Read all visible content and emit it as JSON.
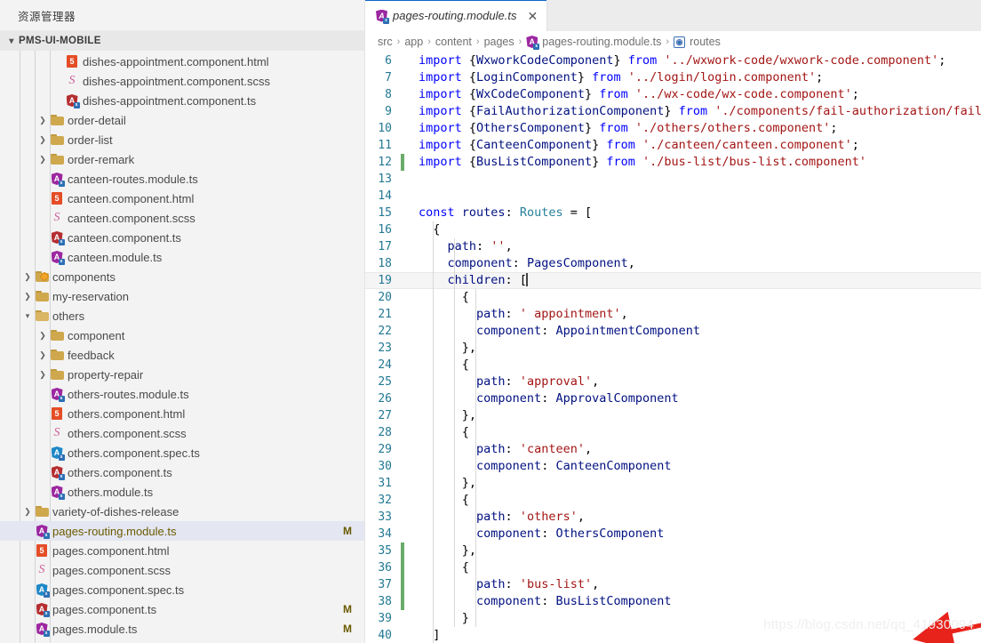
{
  "sidebar": {
    "title": "资源管理器",
    "root_label": "PMS-UI-MOBILE",
    "items": [
      {
        "label": "dishes-appointment.component.html",
        "icon": "html-icon",
        "kind": "file",
        "indent": 3,
        "badge": ""
      },
      {
        "label": "dishes-appointment.component.scss",
        "icon": "scss-icon",
        "kind": "file",
        "indent": 3,
        "badge": ""
      },
      {
        "label": "dishes-appointment.component.ts",
        "icon": "angular-component-icon",
        "kind": "file",
        "indent": 3,
        "badge": ""
      },
      {
        "label": "order-detail",
        "icon": "folder-icon",
        "kind": "folder",
        "indent": 2,
        "state": "collapsed",
        "badge": ""
      },
      {
        "label": "order-list",
        "icon": "folder-icon",
        "kind": "folder",
        "indent": 2,
        "state": "collapsed",
        "badge": ""
      },
      {
        "label": "order-remark",
        "icon": "folder-icon",
        "kind": "folder",
        "indent": 2,
        "state": "collapsed",
        "badge": ""
      },
      {
        "label": "canteen-routes.module.ts",
        "icon": "angular-module-icon",
        "kind": "file",
        "indent": 2,
        "badge": ""
      },
      {
        "label": "canteen.component.html",
        "icon": "html-icon",
        "kind": "file",
        "indent": 2,
        "badge": ""
      },
      {
        "label": "canteen.component.scss",
        "icon": "scss-icon",
        "kind": "file",
        "indent": 2,
        "badge": ""
      },
      {
        "label": "canteen.component.ts",
        "icon": "angular-component-icon",
        "kind": "file",
        "indent": 2,
        "badge": ""
      },
      {
        "label": "canteen.module.ts",
        "icon": "angular-module-icon",
        "kind": "file",
        "indent": 2,
        "badge": ""
      },
      {
        "label": "components",
        "icon": "folder-components-icon",
        "kind": "folder",
        "indent": 1,
        "state": "collapsed",
        "badge": ""
      },
      {
        "label": "my-reservation",
        "icon": "folder-icon",
        "kind": "folder",
        "indent": 1,
        "state": "collapsed",
        "badge": ""
      },
      {
        "label": "others",
        "icon": "folder-open-icon",
        "kind": "folder",
        "indent": 1,
        "state": "expanded",
        "badge": ""
      },
      {
        "label": "component",
        "icon": "folder-icon",
        "kind": "folder",
        "indent": 2,
        "state": "collapsed",
        "badge": ""
      },
      {
        "label": "feedback",
        "icon": "folder-icon",
        "kind": "folder",
        "indent": 2,
        "state": "collapsed",
        "badge": ""
      },
      {
        "label": "property-repair",
        "icon": "folder-icon",
        "kind": "folder",
        "indent": 2,
        "state": "collapsed",
        "badge": ""
      },
      {
        "label": "others-routes.module.ts",
        "icon": "angular-module-icon",
        "kind": "file",
        "indent": 2,
        "badge": ""
      },
      {
        "label": "others.component.html",
        "icon": "html-icon",
        "kind": "file",
        "indent": 2,
        "badge": ""
      },
      {
        "label": "others.component.scss",
        "icon": "scss-icon",
        "kind": "file",
        "indent": 2,
        "badge": ""
      },
      {
        "label": "others.component.spec.ts",
        "icon": "angular-spec-icon",
        "kind": "file",
        "indent": 2,
        "badge": ""
      },
      {
        "label": "others.component.ts",
        "icon": "angular-component-icon",
        "kind": "file",
        "indent": 2,
        "badge": ""
      },
      {
        "label": "others.module.ts",
        "icon": "angular-module-icon",
        "kind": "file",
        "indent": 2,
        "badge": ""
      },
      {
        "label": "variety-of-dishes-release",
        "icon": "folder-icon",
        "kind": "folder",
        "indent": 1,
        "state": "collapsed",
        "badge": ""
      },
      {
        "label": "pages-routing.module.ts",
        "icon": "angular-module-icon",
        "kind": "file",
        "indent": 1,
        "badge": "M",
        "selected": true
      },
      {
        "label": "pages.component.html",
        "icon": "html-icon",
        "kind": "file",
        "indent": 1,
        "badge": ""
      },
      {
        "label": "pages.component.scss",
        "icon": "scss-icon",
        "kind": "file",
        "indent": 1,
        "badge": ""
      },
      {
        "label": "pages.component.spec.ts",
        "icon": "angular-spec-icon",
        "kind": "file",
        "indent": 1,
        "badge": ""
      },
      {
        "label": "pages.component.ts",
        "icon": "angular-component-icon",
        "kind": "file",
        "indent": 1,
        "badge": "M"
      },
      {
        "label": "pages.module.ts",
        "icon": "angular-module-icon",
        "kind": "file",
        "indent": 1,
        "badge": "M"
      }
    ]
  },
  "editor": {
    "tab": {
      "label": "pages-routing.module.ts",
      "icon": "angular-module-icon",
      "close_label": "✕"
    },
    "breadcrumb": [
      "src",
      "app",
      "content",
      "pages",
      "pages-routing.module.ts",
      "routes"
    ],
    "breadcrumb_separator": "›",
    "lines": [
      {
        "n": 6,
        "mod": false,
        "tokens": [
          {
            "t": "kw",
            "v": "import"
          },
          {
            "t": "pn",
            "v": " {"
          },
          {
            "t": "id",
            "v": "WxworkCodeComponent"
          },
          {
            "t": "pn",
            "v": "} "
          },
          {
            "t": "kw",
            "v": "from"
          },
          {
            "t": "pn",
            "v": " "
          },
          {
            "t": "str",
            "v": "'../wxwork-code/wxwork-code.component'"
          },
          {
            "t": "pn",
            "v": ";"
          }
        ]
      },
      {
        "n": 7,
        "mod": false,
        "tokens": [
          {
            "t": "kw",
            "v": "import"
          },
          {
            "t": "pn",
            "v": " {"
          },
          {
            "t": "id",
            "v": "LoginComponent"
          },
          {
            "t": "pn",
            "v": "} "
          },
          {
            "t": "kw",
            "v": "from"
          },
          {
            "t": "pn",
            "v": " "
          },
          {
            "t": "str",
            "v": "'../login/login.component'"
          },
          {
            "t": "pn",
            "v": ";"
          }
        ]
      },
      {
        "n": 8,
        "mod": false,
        "tokens": [
          {
            "t": "kw",
            "v": "import"
          },
          {
            "t": "pn",
            "v": " {"
          },
          {
            "t": "id",
            "v": "WxCodeComponent"
          },
          {
            "t": "pn",
            "v": "} "
          },
          {
            "t": "kw",
            "v": "from"
          },
          {
            "t": "pn",
            "v": " "
          },
          {
            "t": "str",
            "v": "'../wx-code/wx-code.component'"
          },
          {
            "t": "pn",
            "v": ";"
          }
        ]
      },
      {
        "n": 9,
        "mod": false,
        "tokens": [
          {
            "t": "kw",
            "v": "import"
          },
          {
            "t": "pn",
            "v": " {"
          },
          {
            "t": "id",
            "v": "FailAuthorizationComponent"
          },
          {
            "t": "pn",
            "v": "} "
          },
          {
            "t": "kw",
            "v": "from"
          },
          {
            "t": "pn",
            "v": " "
          },
          {
            "t": "str",
            "v": "'./components/fail-authorization/fail-au"
          }
        ]
      },
      {
        "n": 10,
        "mod": false,
        "tokens": [
          {
            "t": "kw",
            "v": "import"
          },
          {
            "t": "pn",
            "v": " {"
          },
          {
            "t": "id",
            "v": "OthersComponent"
          },
          {
            "t": "pn",
            "v": "} "
          },
          {
            "t": "kw",
            "v": "from"
          },
          {
            "t": "pn",
            "v": " "
          },
          {
            "t": "str",
            "v": "'./others/others.component'"
          },
          {
            "t": "pn",
            "v": ";"
          }
        ]
      },
      {
        "n": 11,
        "mod": false,
        "tokens": [
          {
            "t": "kw",
            "v": "import"
          },
          {
            "t": "pn",
            "v": " {"
          },
          {
            "t": "id",
            "v": "CanteenComponent"
          },
          {
            "t": "pn",
            "v": "} "
          },
          {
            "t": "kw",
            "v": "from"
          },
          {
            "t": "pn",
            "v": " "
          },
          {
            "t": "str",
            "v": "'./canteen/canteen.component'"
          },
          {
            "t": "pn",
            "v": ";"
          }
        ]
      },
      {
        "n": 12,
        "mod": true,
        "tokens": [
          {
            "t": "kw",
            "v": "import"
          },
          {
            "t": "pn",
            "v": " {"
          },
          {
            "t": "id",
            "v": "BusListComponent"
          },
          {
            "t": "pn",
            "v": "} "
          },
          {
            "t": "kw",
            "v": "from"
          },
          {
            "t": "pn",
            "v": " "
          },
          {
            "t": "str",
            "v": "'./bus-list/bus-list.component'"
          }
        ]
      },
      {
        "n": 13,
        "mod": false,
        "tokens": []
      },
      {
        "n": 14,
        "mod": false,
        "tokens": []
      },
      {
        "n": 15,
        "mod": false,
        "tokens": [
          {
            "t": "kw",
            "v": "const"
          },
          {
            "t": "pn",
            "v": " "
          },
          {
            "t": "id",
            "v": "routes"
          },
          {
            "t": "pn",
            "v": ": "
          },
          {
            "t": "ty",
            "v": "Routes"
          },
          {
            "t": "pn",
            "v": " = ["
          }
        ]
      },
      {
        "n": 16,
        "mod": false,
        "tokens": [
          {
            "t": "pn",
            "v": "  {"
          }
        ]
      },
      {
        "n": 17,
        "mod": false,
        "tokens": [
          {
            "t": "pn",
            "v": "    "
          },
          {
            "t": "id",
            "v": "path"
          },
          {
            "t": "pn",
            "v": ": "
          },
          {
            "t": "str",
            "v": "''"
          },
          {
            "t": "pn",
            "v": ","
          }
        ]
      },
      {
        "n": 18,
        "mod": false,
        "tokens": [
          {
            "t": "pn",
            "v": "    "
          },
          {
            "t": "id",
            "v": "component"
          },
          {
            "t": "pn",
            "v": ": "
          },
          {
            "t": "id",
            "v": "PagesComponent"
          },
          {
            "t": "pn",
            "v": ","
          }
        ]
      },
      {
        "n": 19,
        "mod": false,
        "current": true,
        "cursor": true,
        "tokens": [
          {
            "t": "pn",
            "v": "    "
          },
          {
            "t": "id",
            "v": "children"
          },
          {
            "t": "pn",
            "v": ": ["
          }
        ]
      },
      {
        "n": 20,
        "mod": false,
        "tokens": [
          {
            "t": "pn",
            "v": "      {"
          }
        ]
      },
      {
        "n": 21,
        "mod": false,
        "tokens": [
          {
            "t": "pn",
            "v": "        "
          },
          {
            "t": "id",
            "v": "path"
          },
          {
            "t": "pn",
            "v": ": "
          },
          {
            "t": "str",
            "v": "' appointment'"
          },
          {
            "t": "pn",
            "v": ","
          }
        ]
      },
      {
        "n": 22,
        "mod": false,
        "tokens": [
          {
            "t": "pn",
            "v": "        "
          },
          {
            "t": "id",
            "v": "component"
          },
          {
            "t": "pn",
            "v": ": "
          },
          {
            "t": "id",
            "v": "AppointmentComponent"
          }
        ]
      },
      {
        "n": 23,
        "mod": false,
        "tokens": [
          {
            "t": "pn",
            "v": "      },"
          }
        ]
      },
      {
        "n": 24,
        "mod": false,
        "tokens": [
          {
            "t": "pn",
            "v": "      {"
          }
        ]
      },
      {
        "n": 25,
        "mod": false,
        "tokens": [
          {
            "t": "pn",
            "v": "        "
          },
          {
            "t": "id",
            "v": "path"
          },
          {
            "t": "pn",
            "v": ": "
          },
          {
            "t": "str",
            "v": "'approval'"
          },
          {
            "t": "pn",
            "v": ","
          }
        ]
      },
      {
        "n": 26,
        "mod": false,
        "tokens": [
          {
            "t": "pn",
            "v": "        "
          },
          {
            "t": "id",
            "v": "component"
          },
          {
            "t": "pn",
            "v": ": "
          },
          {
            "t": "id",
            "v": "ApprovalComponent"
          }
        ]
      },
      {
        "n": 27,
        "mod": false,
        "tokens": [
          {
            "t": "pn",
            "v": "      },"
          }
        ]
      },
      {
        "n": 28,
        "mod": false,
        "tokens": [
          {
            "t": "pn",
            "v": "      {"
          }
        ]
      },
      {
        "n": 29,
        "mod": false,
        "tokens": [
          {
            "t": "pn",
            "v": "        "
          },
          {
            "t": "id",
            "v": "path"
          },
          {
            "t": "pn",
            "v": ": "
          },
          {
            "t": "str",
            "v": "'canteen'"
          },
          {
            "t": "pn",
            "v": ","
          }
        ]
      },
      {
        "n": 30,
        "mod": false,
        "tokens": [
          {
            "t": "pn",
            "v": "        "
          },
          {
            "t": "id",
            "v": "component"
          },
          {
            "t": "pn",
            "v": ": "
          },
          {
            "t": "id",
            "v": "CanteenComponent"
          }
        ]
      },
      {
        "n": 31,
        "mod": false,
        "tokens": [
          {
            "t": "pn",
            "v": "      },"
          }
        ]
      },
      {
        "n": 32,
        "mod": false,
        "tokens": [
          {
            "t": "pn",
            "v": "      {"
          }
        ]
      },
      {
        "n": 33,
        "mod": false,
        "tokens": [
          {
            "t": "pn",
            "v": "        "
          },
          {
            "t": "id",
            "v": "path"
          },
          {
            "t": "pn",
            "v": ": "
          },
          {
            "t": "str",
            "v": "'others'"
          },
          {
            "t": "pn",
            "v": ","
          }
        ]
      },
      {
        "n": 34,
        "mod": false,
        "tokens": [
          {
            "t": "pn",
            "v": "        "
          },
          {
            "t": "id",
            "v": "component"
          },
          {
            "t": "pn",
            "v": ": "
          },
          {
            "t": "id",
            "v": "OthersComponent"
          }
        ]
      },
      {
        "n": 35,
        "mod": true,
        "tokens": [
          {
            "t": "pn",
            "v": "      },"
          }
        ]
      },
      {
        "n": 36,
        "mod": true,
        "tokens": [
          {
            "t": "pn",
            "v": "      {"
          }
        ]
      },
      {
        "n": 37,
        "mod": true,
        "tokens": [
          {
            "t": "pn",
            "v": "        "
          },
          {
            "t": "id",
            "v": "path"
          },
          {
            "t": "pn",
            "v": ": "
          },
          {
            "t": "str",
            "v": "'bus-list'"
          },
          {
            "t": "pn",
            "v": ","
          }
        ]
      },
      {
        "n": 38,
        "mod": true,
        "tokens": [
          {
            "t": "pn",
            "v": "        "
          },
          {
            "t": "id",
            "v": "component"
          },
          {
            "t": "pn",
            "v": ": "
          },
          {
            "t": "id",
            "v": "BusListComponent"
          }
        ]
      },
      {
        "n": 39,
        "mod": false,
        "tokens": [
          {
            "t": "pn",
            "v": "      }"
          }
        ]
      },
      {
        "n": 40,
        "mod": false,
        "tokens": [
          {
            "t": "pn",
            "v": "  ]"
          }
        ]
      }
    ]
  },
  "annotation": {
    "arrow_color": "#e8231b"
  },
  "watermark": {
    "text": "https://blog.csdn.net/qq_41930094"
  }
}
